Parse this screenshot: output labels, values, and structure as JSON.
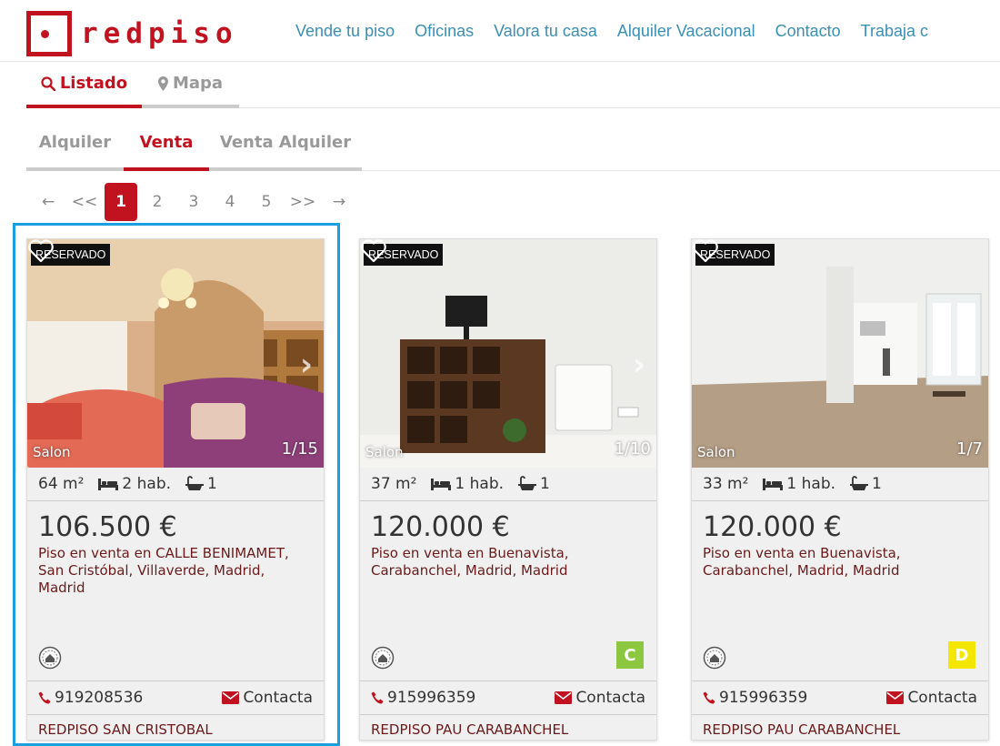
{
  "logo": {
    "text": "redpiso"
  },
  "nav": [
    "Vende tu piso",
    "Oficinas",
    "Valora tu casa",
    "Alquiler Vacacional",
    "Contacto",
    "Trabaja c"
  ],
  "view_tabs": [
    {
      "label": "Listado",
      "icon": "search-icon",
      "active": true
    },
    {
      "label": "Mapa",
      "icon": "map-marker-icon",
      "active": false
    }
  ],
  "type_tabs": [
    {
      "label": "Alquiler",
      "active": false
    },
    {
      "label": "Venta",
      "active": true
    },
    {
      "label": "Venta Alquiler",
      "active": false
    }
  ],
  "pagination": [
    "←",
    "<<",
    "1",
    "2",
    "3",
    "4",
    "5",
    ">>",
    "→"
  ],
  "pagination_active": "1",
  "colors": {
    "brand": "#c1121f",
    "link": "#3a8fb5",
    "selection": "#1a9fe0",
    "energy_c": "#8dc63f",
    "energy_d": "#f5e600"
  },
  "listings": [
    {
      "badge": "RESERVADO",
      "room": "Salon",
      "counter": "1/15",
      "area": "64 m²",
      "rooms": "2 hab.",
      "baths": "1",
      "price": "106.500 €",
      "description": "Piso en venta en CALLE BENIMAMET, San Cristóbal, Villaverde, Madrid, Madrid",
      "energy": "",
      "phone": "919208536",
      "contact": "Contacta",
      "office": "REDPISO SAN CRISTOBAL"
    },
    {
      "badge": "RESERVADO",
      "room": "Salon",
      "counter": "1/10",
      "area": "37 m²",
      "rooms": "1 hab.",
      "baths": "1",
      "price": "120.000 €",
      "description": "Piso en venta en Buenavista, Carabanchel, Madrid, Madrid",
      "energy": "C",
      "phone": "915996359",
      "contact": "Contacta",
      "office": "REDPISO PAU CARABANCHEL"
    },
    {
      "badge": "RESERVADO",
      "room": "Salon",
      "counter": "1/7",
      "area": "33 m²",
      "rooms": "1 hab.",
      "baths": "1",
      "price": "120.000 €",
      "description": "Piso en venta en Buenavista, Carabanchel, Madrid, Madrid",
      "energy": "D",
      "phone": "915996359",
      "contact": "Contacta",
      "office": "REDPISO PAU CARABANCHEL"
    }
  ]
}
